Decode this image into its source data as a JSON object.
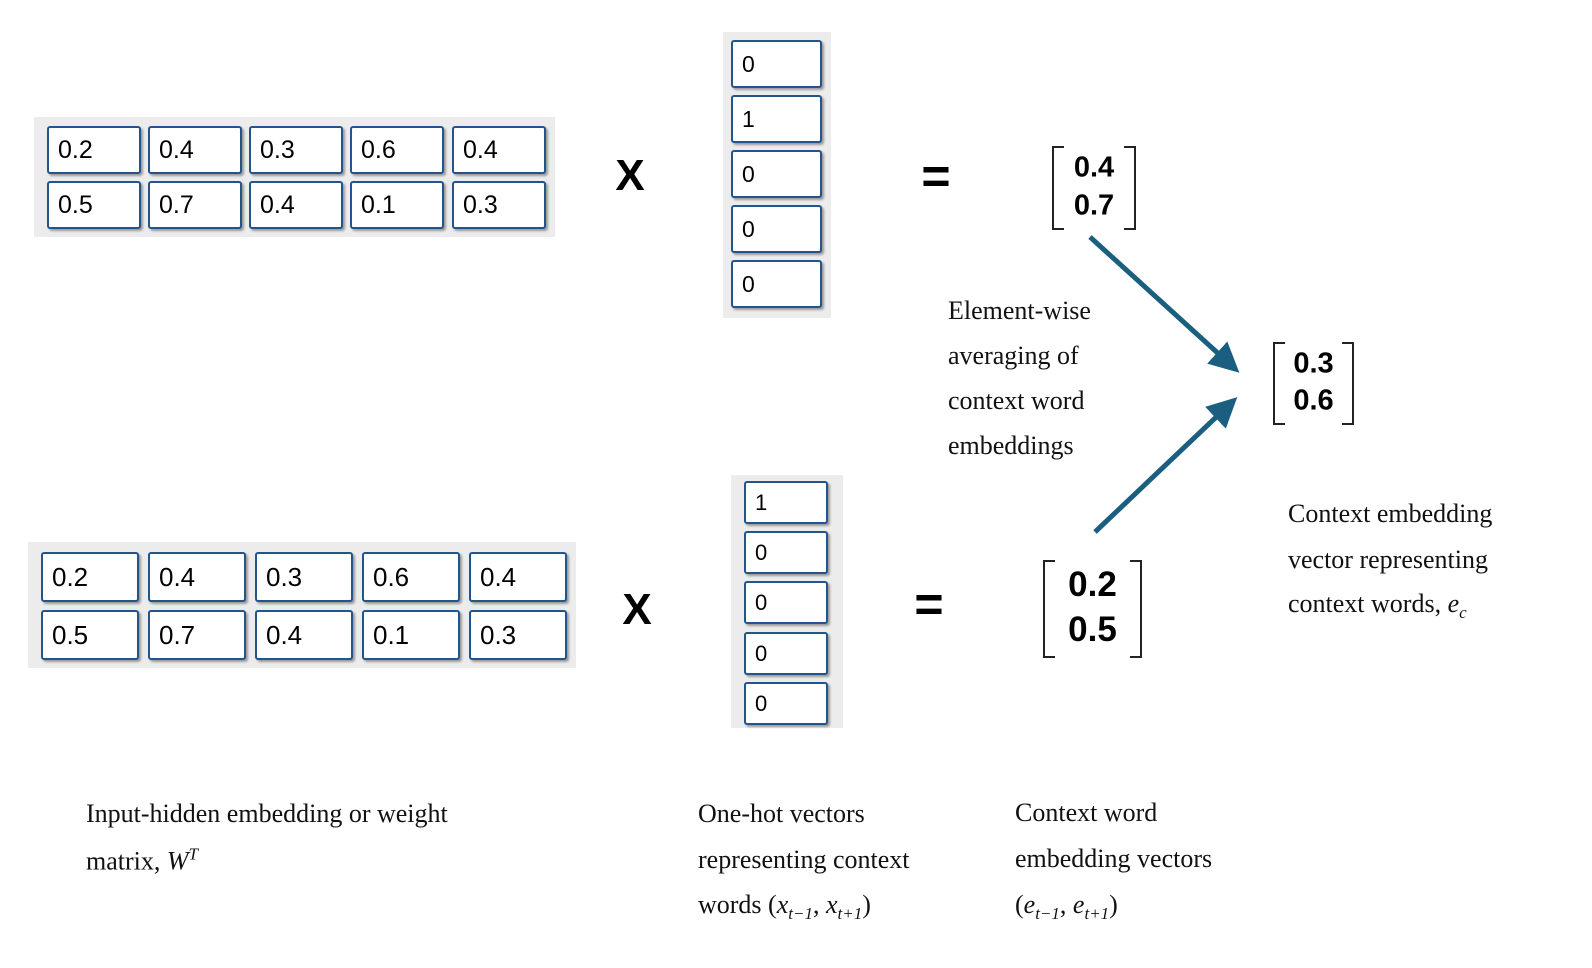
{
  "top": {
    "matrix": [
      [
        "0.2",
        "0.4",
        "0.3",
        "0.6",
        "0.4"
      ],
      [
        "0.5",
        "0.7",
        "0.4",
        "0.1",
        "0.3"
      ]
    ],
    "times": "X",
    "onehot": [
      "0",
      "1",
      "0",
      "0",
      "0"
    ],
    "equals": "=",
    "result": [
      "0.4",
      "0.7"
    ]
  },
  "bottom": {
    "matrix": [
      [
        "0.2",
        "0.4",
        "0.3",
        "0.6",
        "0.4"
      ],
      [
        "0.5",
        "0.7",
        "0.4",
        "0.1",
        "0.3"
      ]
    ],
    "times": "X",
    "onehot": [
      "1",
      "0",
      "0",
      "0",
      "0"
    ],
    "equals": "=",
    "result": [
      "0.2",
      "0.5"
    ]
  },
  "context_vector": [
    "0.3",
    "0.6"
  ],
  "arrow_color": "#1a5f80",
  "cell_border_color": "#24548c",
  "averaging_label": [
    "Element-wise",
    "averaging of",
    "context word",
    "embeddings"
  ],
  "context_label": {
    "lines": [
      "Context embedding",
      "vector representing",
      "context words, "
    ],
    "symbol": "e",
    "sub": "c"
  },
  "matrix_label": {
    "line1": "Input-hidden embedding or weight",
    "line2": "matrix, ",
    "symbol": "W",
    "sup": "T"
  },
  "onehot_label": {
    "line1": "One-hot vectors",
    "line2": "representing context",
    "line3": "words (",
    "x1": "x",
    "x1sub": "t−1",
    "sep": ", ",
    "x2": "x",
    "x2sub": "t+1",
    "close": ")"
  },
  "embedding_label": {
    "line1": "Context word",
    "line2": "embedding vectors",
    "open": "(",
    "e1": "e",
    "e1sub": "t−1",
    "sep": ", ",
    "e2": "e",
    "e2sub": "t+1",
    "close": ")"
  }
}
